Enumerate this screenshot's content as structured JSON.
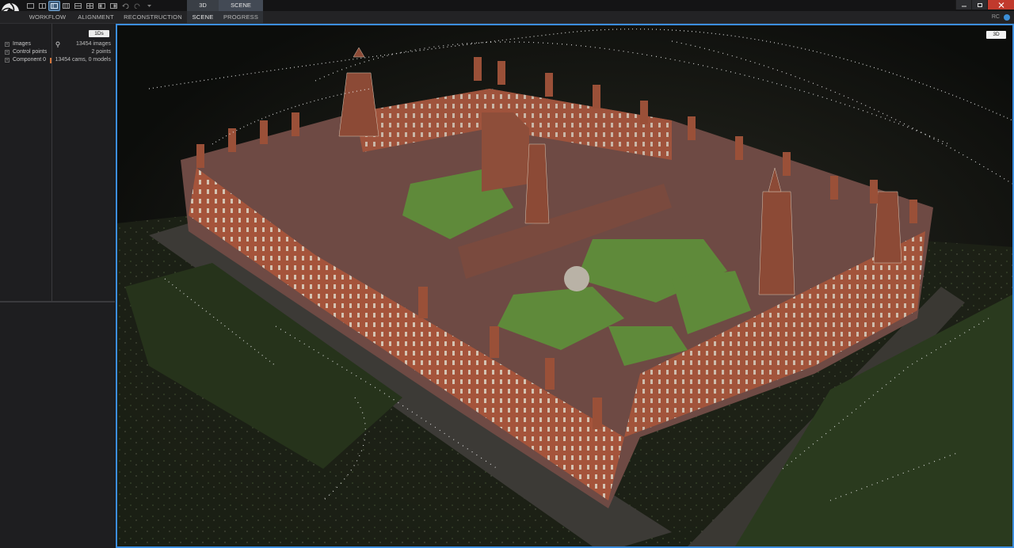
{
  "quick_access": {
    "icons": [
      "layout-1-icon",
      "layout-2-icon",
      "layout-3-icon",
      "layout-4-icon",
      "layout-5-icon",
      "layout-6-icon",
      "layout-7-icon",
      "layout-8-icon",
      "undo-icon",
      "redo-icon",
      "customize-icon"
    ],
    "active_index": 2
  },
  "context_tabs": {
    "tab_3d": "3D",
    "tab_scene": "SCENE"
  },
  "ribbon": {
    "tabs": [
      "WORKFLOW",
      "ALIGNMENT",
      "RECONSTRUCTION",
      "SCENE",
      "PROGRESS"
    ],
    "active": "SCENE",
    "right_label": "RC"
  },
  "left_panel": {
    "badge": "1Ds",
    "tree": [
      {
        "name": "Images",
        "value": "13454 images"
      },
      {
        "name": "Control points",
        "value": "2 points"
      },
      {
        "name": "Component 0",
        "value": "13454 cams, 0 models"
      }
    ]
  },
  "viewport": {
    "badge": "3D"
  },
  "colors": {
    "accent": "#3c8ee0",
    "close": "#c13a2d",
    "brick": "#a8553a",
    "roof": "#6e4a44",
    "lawn": "#5f8a3a"
  }
}
